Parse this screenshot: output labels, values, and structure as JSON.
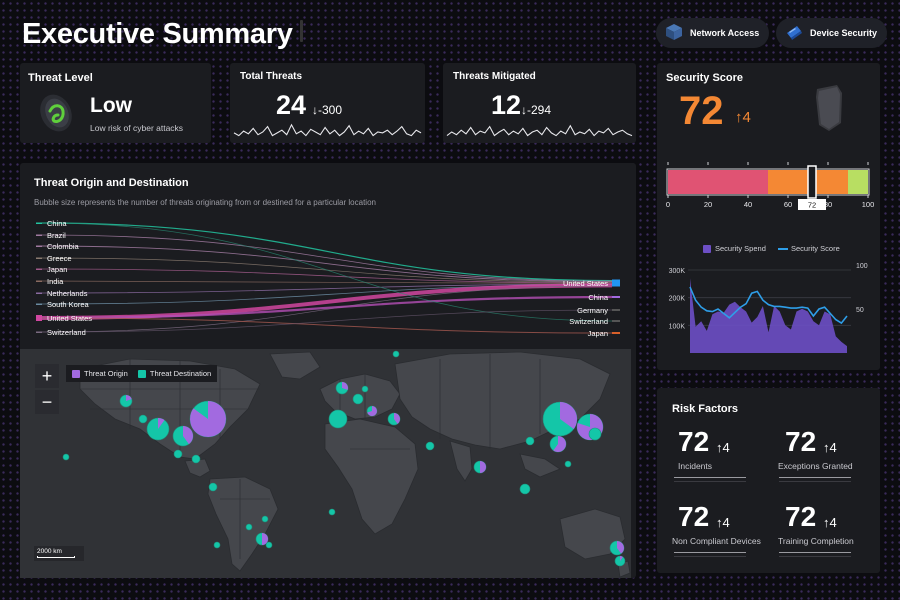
{
  "header": {
    "title": "Executive Summary",
    "buttons": [
      {
        "label": "Network Access",
        "icon": "network-cube-icon"
      },
      {
        "label": "Device Security",
        "icon": "device-tilt-icon"
      }
    ]
  },
  "threat_level": {
    "title": "Threat Level",
    "value": "Low",
    "description": "Low risk of cyber attacks",
    "icon": "tilted-shield-icon"
  },
  "total_threats": {
    "title": "Total Threats",
    "value": "24",
    "delta": "↓-300",
    "sparkline": [
      0.45,
      0.3,
      0.55,
      0.4,
      0.7,
      0.35,
      0.5,
      0.8,
      0.3,
      0.45,
      0.6,
      0.35,
      0.9,
      0.4,
      0.55,
      0.3,
      0.65,
      0.5,
      0.35,
      0.75,
      0.4,
      0.6,
      0.3,
      0.5,
      0.85,
      0.35,
      0.55,
      0.4,
      0.7,
      0.3,
      0.5,
      0.45,
      0.6,
      0.35,
      0.55,
      0.8,
      0.4,
      0.3,
      0.6,
      0.45
    ]
  },
  "threats_mitigated": {
    "title": "Threats Mitigated",
    "value": "12",
    "delta": "↓-294",
    "sparkline": [
      0.3,
      0.5,
      0.35,
      0.6,
      0.4,
      0.75,
      0.35,
      0.55,
      0.45,
      0.8,
      0.3,
      0.5,
      0.65,
      0.35,
      0.55,
      0.4,
      0.7,
      0.3,
      0.5,
      0.6,
      0.35,
      0.75,
      0.45,
      0.3,
      0.55,
      0.4,
      0.85,
      0.35,
      0.5,
      0.4,
      0.65,
      0.3,
      0.55,
      0.45,
      0.7,
      0.35,
      0.5,
      0.6,
      0.4,
      0.3
    ]
  },
  "security_score": {
    "title": "Security Score",
    "value": "72",
    "delta": "↑4",
    "icon": "shield-shape-icon",
    "gauge": {
      "value": 72,
      "value_label": "72",
      "range": [
        0,
        100
      ],
      "ticks": [
        "0",
        "20",
        "40",
        "60",
        "80",
        "100"
      ],
      "bands": [
        {
          "from": 0,
          "to": 50,
          "color": "#e05373"
        },
        {
          "from": 50,
          "to": 90,
          "color": "#f48834"
        },
        {
          "from": 90,
          "to": 100,
          "color": "#b8de62"
        }
      ]
    }
  },
  "spend_chart": {
    "legend": [
      "Security Spend",
      "Security Score"
    ],
    "left_ticks": [
      "300K",
      "200K",
      "100K"
    ],
    "right_ticks": [
      "100",
      "50"
    ]
  },
  "chart_data": {
    "type": "area",
    "x": [
      1,
      2,
      3,
      4,
      5,
      6,
      7,
      8,
      9,
      10,
      11,
      12,
      13,
      14,
      15,
      16,
      17,
      18,
      19,
      20,
      21,
      22,
      23,
      24,
      25,
      26,
      27,
      28,
      29
    ],
    "series": [
      {
        "name": "Security Spend",
        "type": "area",
        "axis": "left",
        "color": "#6d4fc5",
        "values": [
          270000,
          95000,
          115000,
          80000,
          140000,
          150000,
          145000,
          175000,
          185000,
          165000,
          150000,
          110000,
          130000,
          170000,
          75000,
          170000,
          150000,
          100000,
          85000,
          150000,
          160000,
          150000,
          115000,
          100000,
          150000,
          140000,
          60000,
          40000,
          25000
        ]
      },
      {
        "name": "Security Score",
        "type": "line",
        "axis": "right",
        "color": "#2e9ee8",
        "values": [
          75,
          60,
          52,
          48,
          47,
          50,
          45,
          40,
          46,
          52,
          56,
          68,
          70,
          60,
          55,
          53,
          53,
          52,
          51,
          51,
          52,
          51,
          42,
          50,
          52,
          45,
          38,
          34,
          42
        ]
      }
    ],
    "ylim_left": [
      0,
      300000
    ],
    "ylim_right": [
      0,
      100
    ]
  },
  "threat_origin": {
    "title": "Threat Origin and Destination",
    "subtitle": "Bubble size represents the number of threats originating from or destined for a particular location",
    "origins": [
      {
        "label": "China",
        "color": "#22c4a0"
      },
      {
        "label": "Brazil",
        "color": "#a07aa0"
      },
      {
        "label": "Colombia",
        "color": "#a07aa0"
      },
      {
        "label": "Greece",
        "color": "#8a7a70"
      },
      {
        "label": "Japan",
        "color": "#a05a8a"
      },
      {
        "label": "India",
        "color": "#8a6a60"
      },
      {
        "label": "Netherlands",
        "color": "#8a6aa0"
      },
      {
        "label": "South Korea",
        "color": "#6a8aa0"
      },
      {
        "label": "United States",
        "color": "#d047a0"
      },
      {
        "label": "Switzerland",
        "color": "#7a6a80"
      }
    ],
    "destinations": [
      {
        "label": "United States",
        "color": "#2196f3"
      },
      {
        "label": "China",
        "color": "#a26ae0"
      },
      {
        "label": "Germany",
        "color": "#555555"
      },
      {
        "label": "Switzerland",
        "color": "#555555"
      },
      {
        "label": "Japan",
        "color": "#d9602a"
      }
    ]
  },
  "map": {
    "legend": [
      "Threat Origin",
      "Threat Destination"
    ],
    "legend_colors": [
      "#a26ae0",
      "#14c6a8"
    ],
    "zoom_in": "+",
    "zoom_out": "−",
    "scale": "2000 km"
  },
  "risk_factors": {
    "title": "Risk Factors",
    "items": [
      {
        "value": "72",
        "delta": "↑4",
        "label": "Incidents"
      },
      {
        "value": "72",
        "delta": "↑4",
        "label": "Exceptions Granted"
      },
      {
        "value": "72",
        "delta": "↑4",
        "label": "Non Compliant Devices"
      },
      {
        "value": "72",
        "delta": "↑4",
        "label": "Training Completion"
      }
    ]
  }
}
